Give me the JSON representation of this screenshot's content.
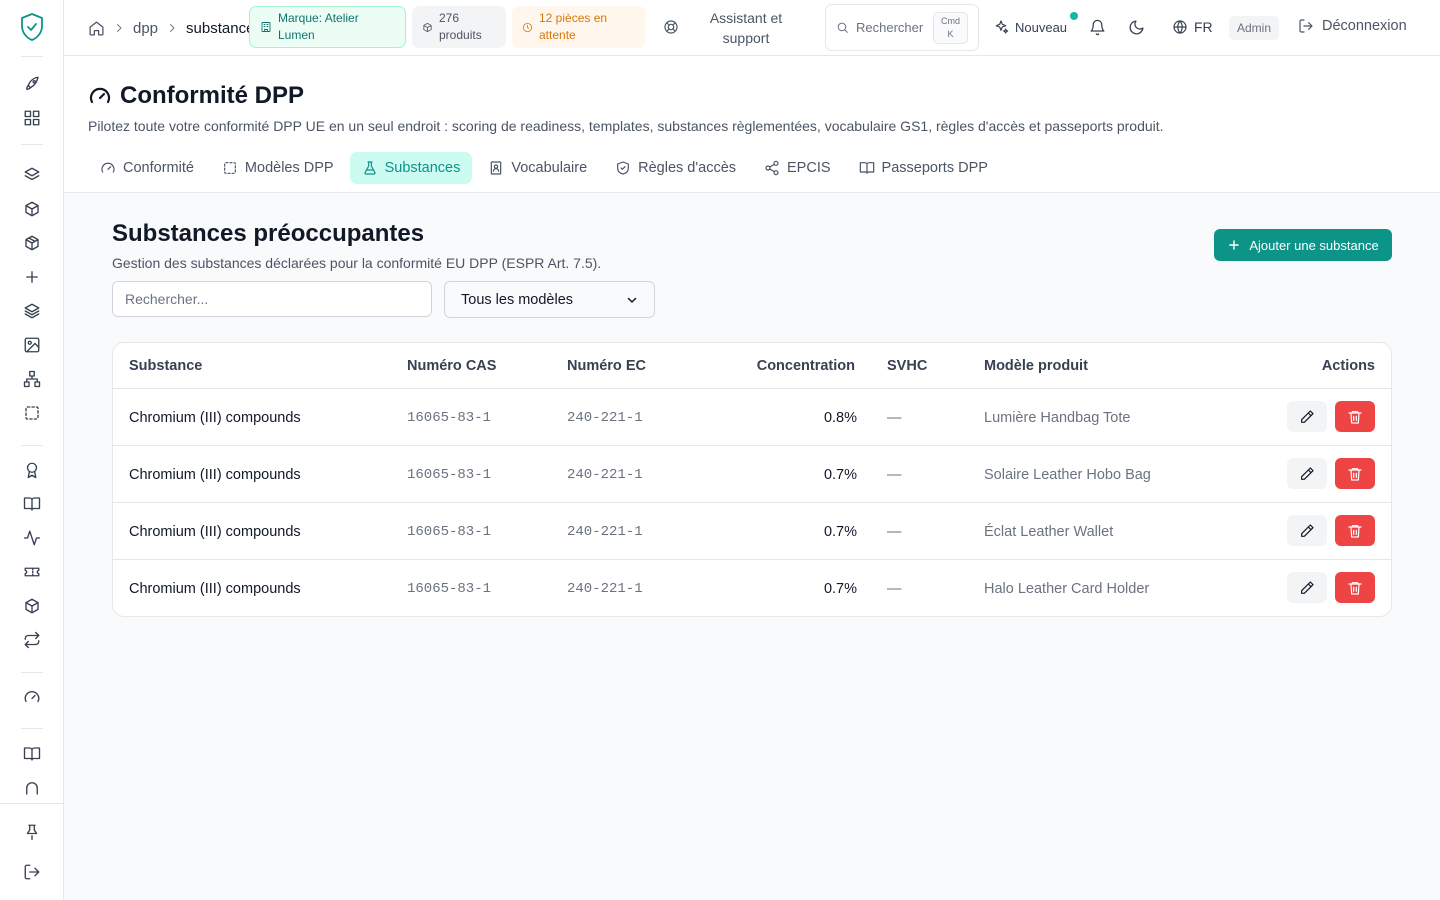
{
  "topbar": {
    "breadcrumb": [
      "dpp",
      "substances"
    ],
    "brand_badge": "Marque: Atelier Lumen",
    "products_badge": "276 produits",
    "pending_badge": "12 pièces en attente",
    "support": "Assistant et support",
    "search_label": "Rechercher",
    "kbd_1": "Cmd",
    "kbd_2": "K",
    "new_label": "Nouveau",
    "lang": "FR",
    "role": "Admin",
    "logout": "Déconnexion"
  },
  "page": {
    "title": "Conformité DPP",
    "subtitle": "Pilotez toute votre conformité DPP UE en un seul endroit : scoring de readiness, templates, substances règlementées, vocabulaire GS1, règles d'accès et passeports produit.",
    "tabs": [
      {
        "label": "Conformité",
        "icon": "gauge-icon"
      },
      {
        "label": "Modèles DPP",
        "icon": "dashed-square-icon"
      },
      {
        "label": "Substances",
        "icon": "flask-icon",
        "active": true
      },
      {
        "label": "Vocabulaire",
        "icon": "book-user-icon"
      },
      {
        "label": "Règles d'accès",
        "icon": "shield-check-icon"
      },
      {
        "label": "EPCIS",
        "icon": "share-icon"
      },
      {
        "label": "Passeports DPP",
        "icon": "open-book-icon"
      }
    ]
  },
  "substances": {
    "title": "Substances préoccupantes",
    "subtitle": "Gestion des substances déclarées pour la conformité EU DPP (ESPR Art. 7.5).",
    "add_button": "Ajouter une substance",
    "search_placeholder": "Rechercher...",
    "filter_value": "Tous les modèles",
    "columns": [
      "Substance",
      "Numéro CAS",
      "Numéro EC",
      "Concentration",
      "SVHC",
      "Modèle produit",
      "Actions"
    ],
    "rows": [
      {
        "substance": "Chromium (III) compounds",
        "cas": "16065-83-1",
        "ec": "240-221-1",
        "concentration": "0.8%",
        "svhc": "—",
        "model": "Lumière Handbag Tote"
      },
      {
        "substance": "Chromium (III) compounds",
        "cas": "16065-83-1",
        "ec": "240-221-1",
        "concentration": "0.7%",
        "svhc": "—",
        "model": "Solaire Leather Hobo Bag"
      },
      {
        "substance": "Chromium (III) compounds",
        "cas": "16065-83-1",
        "ec": "240-221-1",
        "concentration": "0.7%",
        "svhc": "—",
        "model": "Éclat Leather Wallet"
      },
      {
        "substance": "Chromium (III) compounds",
        "cas": "16065-83-1",
        "ec": "240-221-1",
        "concentration": "0.7%",
        "svhc": "—",
        "model": "Halo Leather Card Holder"
      }
    ]
  },
  "colors": {
    "accent": "#0d9488",
    "danger": "#ef4444",
    "warning": "#d97706"
  }
}
